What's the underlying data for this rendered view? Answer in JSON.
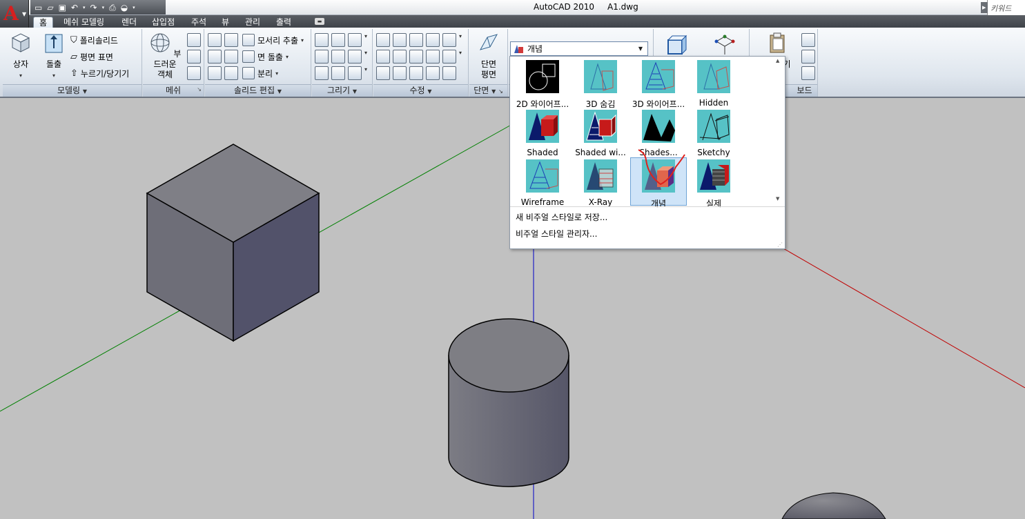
{
  "title_bar": {
    "app_name": "AutoCAD 2010",
    "file_name": "A1.dwg",
    "keyword_search": "키워드",
    "quick_access": [
      "new-icon",
      "open-icon",
      "save-icon",
      "undo-icon",
      "redo-icon",
      "plot-icon",
      "workspace-icon"
    ]
  },
  "menu_tabs": [
    "홈",
    "메쉬 모델링",
    "렌더",
    "삽입점",
    "주석",
    "뷰",
    "관리",
    "출력"
  ],
  "ribbon": {
    "modeling": {
      "title": "모델링",
      "box_label": "상자",
      "extrude_label": "돌출",
      "polysolid": "폴리솔리드",
      "planar_surface": "평면 표면",
      "presspull": "누르기/당기기"
    },
    "mesh": {
      "title": "메쉬",
      "smooth_label_1": "부드러운",
      "smooth_label_2": "객체"
    },
    "solid_edit": {
      "title": "솔리드 편집",
      "extract_edges": "모서리 추출",
      "extrude_faces": "면 돌출",
      "separate": "분리"
    },
    "draw": {
      "title": "그리기"
    },
    "modify": {
      "title": "수정"
    },
    "section": {
      "title": "단면",
      "plane_label_1": "단면",
      "plane_label_2": "평면"
    },
    "clipboard": {
      "title_fragment": "보드",
      "paste_fragment": "기"
    }
  },
  "visual_styles": {
    "current": "개념",
    "items": [
      {
        "label": "2D 와이어프...",
        "thumb": "wireframe-2d"
      },
      {
        "label": "3D 숨김",
        "thumb": "hidden-3d"
      },
      {
        "label": "3D 와이어프...",
        "thumb": "wireframe-3d"
      },
      {
        "label": "Hidden",
        "thumb": "hidden"
      },
      {
        "label": "Shaded",
        "thumb": "shaded"
      },
      {
        "label": "Shaded wi...",
        "thumb": "shaded-edges"
      },
      {
        "label": "Shades...",
        "thumb": "shades-gray"
      },
      {
        "label": "Sketchy",
        "thumb": "sketchy"
      },
      {
        "label": "Wireframe",
        "thumb": "wireframe"
      },
      {
        "label": "X-Ray",
        "thumb": "xray"
      },
      {
        "label": "개념",
        "thumb": "conceptual"
      },
      {
        "label": "실제",
        "thumb": "realistic"
      }
    ],
    "selected_index": 10,
    "commands": [
      "새 비주얼 스타일로 저장...",
      "비주얼 스타일 관리자..."
    ]
  },
  "colors": {
    "viewport_bg": "#c1c1c1",
    "x_axis": "#c00000",
    "y_axis": "#008000",
    "z_axis": "#0000c8",
    "thumb_bg": "#56c2c6",
    "annotation": "#e0201c"
  }
}
